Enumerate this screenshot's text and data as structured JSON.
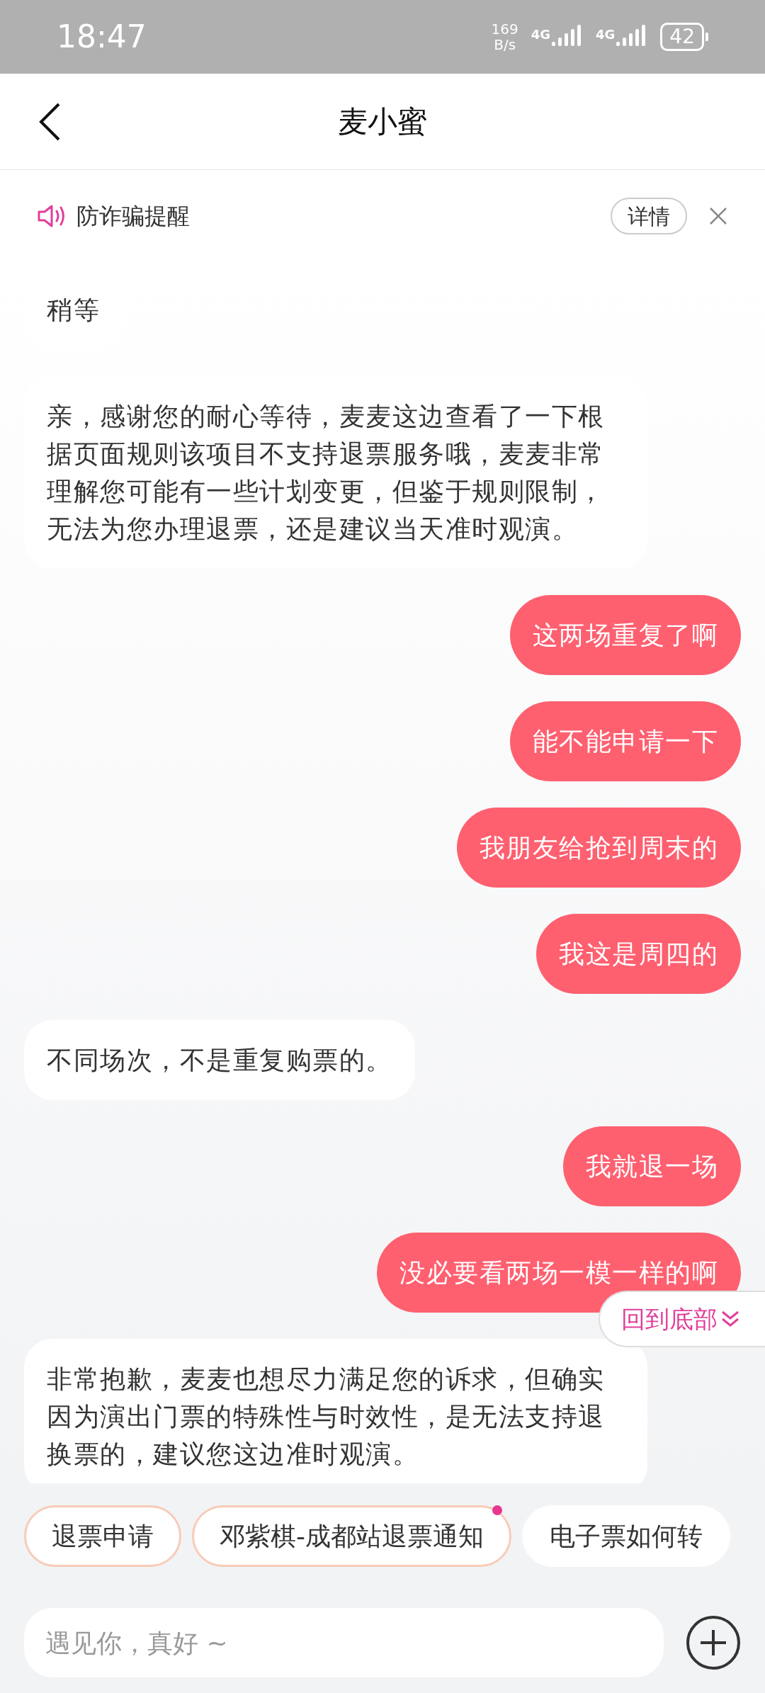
{
  "status_bar": {
    "time": "18:47",
    "net_speed": [
      "169",
      "B/s"
    ],
    "signals": [
      "4G",
      "4G"
    ],
    "battery": "42"
  },
  "header": {
    "title": "麦小蜜"
  },
  "notice": {
    "text": "防诈骗提醒",
    "button": "详情"
  },
  "messages": [
    {
      "kind": "bot",
      "text": "稍等"
    },
    {
      "kind": "bot",
      "text": "亲，感谢您的耐心等待，麦麦这边查看了一下根据页面规则该项目不支持退票服务哦，麦麦非常理解您可能有一些计划变更，但鉴于规则限制，无法为您办理退票，还是建议当天准时观演。"
    },
    {
      "kind": "user",
      "text": "这两场重复了啊"
    },
    {
      "kind": "user",
      "text": "能不能申请一下"
    },
    {
      "kind": "user",
      "text": "我朋友给抢到周末的"
    },
    {
      "kind": "user",
      "text": "我这是周四的"
    },
    {
      "kind": "bot",
      "text": "不同场次，不是重复购票的。"
    },
    {
      "kind": "user",
      "text": "我就退一场"
    },
    {
      "kind": "user",
      "text": "没必要看两场一模一样的啊"
    },
    {
      "kind": "bot",
      "text": "非常抱歉，麦麦也想尽力满足您的诉求，但确实因为演出门票的特殊性与时效性，是无法支持退换票的，建议您这边准时观演。"
    }
  ],
  "jump_button": "回到底部",
  "quick_replies": [
    {
      "label": "退票申请",
      "unread": false,
      "outlined": true
    },
    {
      "label": "邓紫棋-成都站退票通知",
      "unread": true,
      "outlined": true
    },
    {
      "label": "电子票如何转",
      "unread": false,
      "outlined": false
    }
  ],
  "input": {
    "placeholder": "遇见你，真好 ~"
  }
}
